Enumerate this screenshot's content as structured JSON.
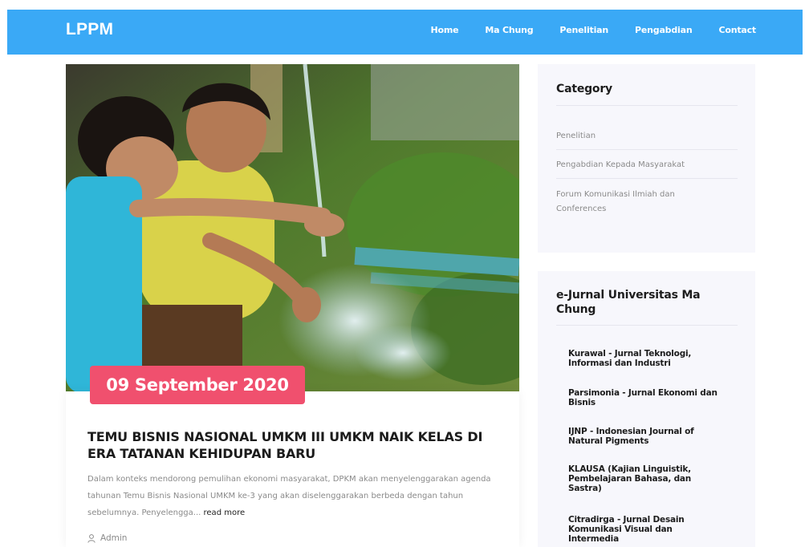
{
  "navbar": {
    "brand": "LPPM",
    "links": [
      "Home",
      "Ma Chung",
      "Penelitian",
      "Pengabdian",
      "Contact"
    ]
  },
  "post": {
    "date": "09 September 2020",
    "title": "TEMU BISNIS NASIONAL UMKM III UMKM NAIK KELAS DI ERA TATANAN KEHIDUPAN BARU",
    "excerpt": "Dalam konteks mendorong pemulihan ekonomi masyarakat, DPKM akan menyelenggarakan agenda tahunan Temu Bisnis Nasional UMKM ke-3 yang akan diselenggarakan berbeda dengan tahun sebelumnya. Penyelengga...",
    "read_more": "read more",
    "author": "Admin",
    "image_alt_icon": "children-water-photo"
  },
  "sidebar": {
    "category": {
      "title": "Category",
      "items": [
        "Penelitian",
        "Pengabdian Kepada Masyarakat",
        "Forum Komunikasi Ilmiah dan Conferences"
      ]
    },
    "journals": {
      "title": "e-Jurnal Universitas Ma Chung",
      "items": [
        "Kurawal - Jurnal Teknologi, Informasi dan Industri",
        "Parsimonia - Jurnal Ekonomi dan Bisnis",
        "IJNP - Indonesian Journal of Natural Pigments",
        "KLAUSA (Kajian Linguistik, Pembelajaran Bahasa, dan Sastra)",
        "Citradirga - Jurnal Desain Komunikasi Visual dan Intermedia"
      ]
    }
  },
  "colors": {
    "navbar": "#3aa9f6",
    "date_badge": "#f0506e",
    "sidebar_bg": "#f7f7fc"
  }
}
